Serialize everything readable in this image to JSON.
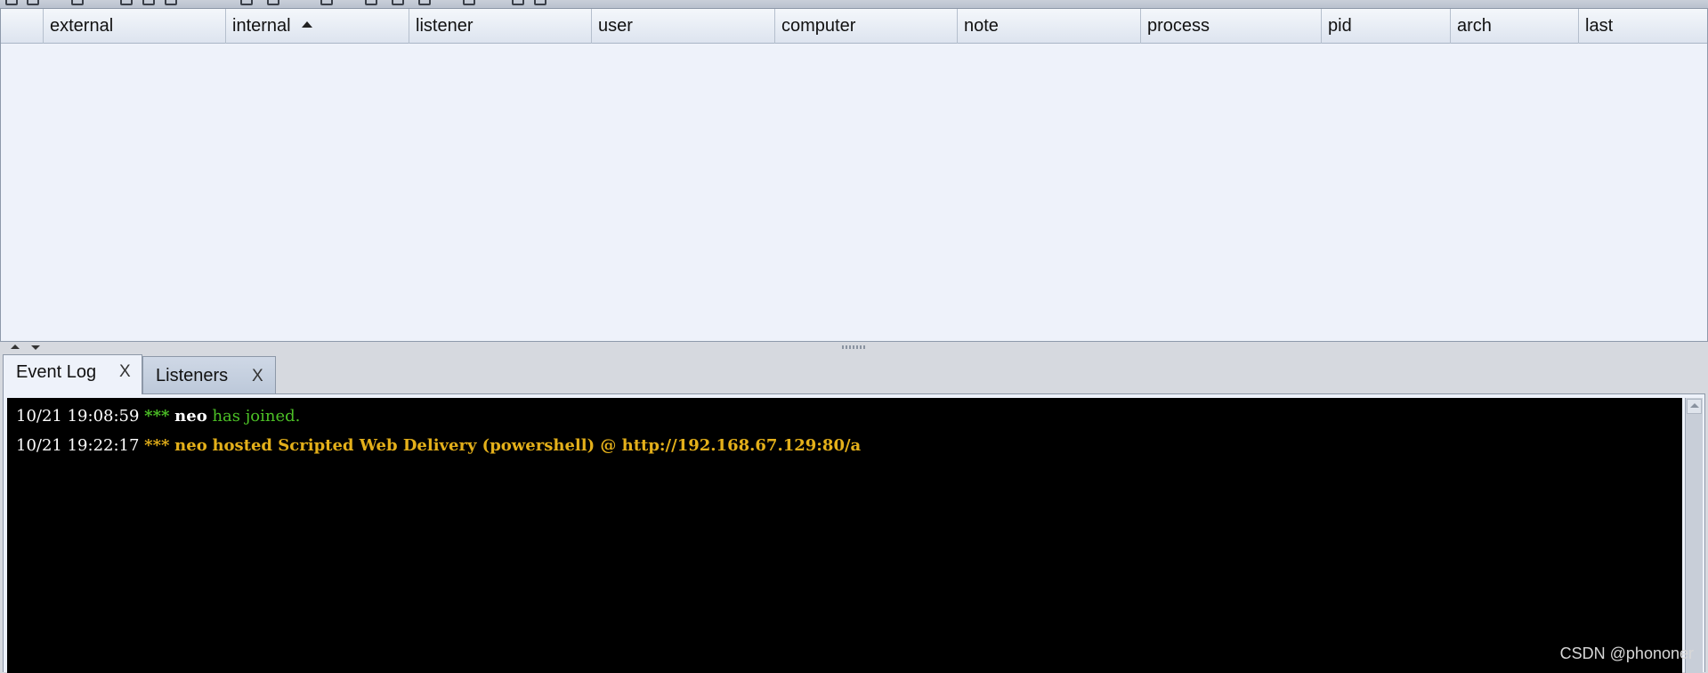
{
  "table": {
    "columns": [
      {
        "key": "blank",
        "label": ""
      },
      {
        "key": "external",
        "label": "external"
      },
      {
        "key": "internal",
        "label": "internal",
        "sorted": "ascending"
      },
      {
        "key": "listener",
        "label": "listener"
      },
      {
        "key": "user",
        "label": "user"
      },
      {
        "key": "computer",
        "label": "computer"
      },
      {
        "key": "note",
        "label": "note"
      },
      {
        "key": "process",
        "label": "process"
      },
      {
        "key": "pid",
        "label": "pid"
      },
      {
        "key": "arch",
        "label": "arch"
      },
      {
        "key": "last",
        "label": "last"
      }
    ],
    "rows": []
  },
  "tabs": [
    {
      "label": "Event Log",
      "close": "X",
      "active": true
    },
    {
      "label": "Listeners",
      "close": "X",
      "active": false
    }
  ],
  "event_log": [
    {
      "timestamp": "10/21 19:08:59",
      "stars": "***",
      "user": "neo",
      "message": "has joined.",
      "style": "join"
    },
    {
      "timestamp": "10/21 19:22:17",
      "stars": "***",
      "user": "neo",
      "message": "hosted Scripted Web Delivery (powershell) @ http://192.168.67.129:80/a",
      "style": "action"
    }
  ],
  "watermark": "CSDN @phononer",
  "colors": {
    "console_bg": "#000000",
    "join_green": "#4cc026",
    "action_yellow": "#e4b01a",
    "table_bg": "#eef2fa"
  }
}
